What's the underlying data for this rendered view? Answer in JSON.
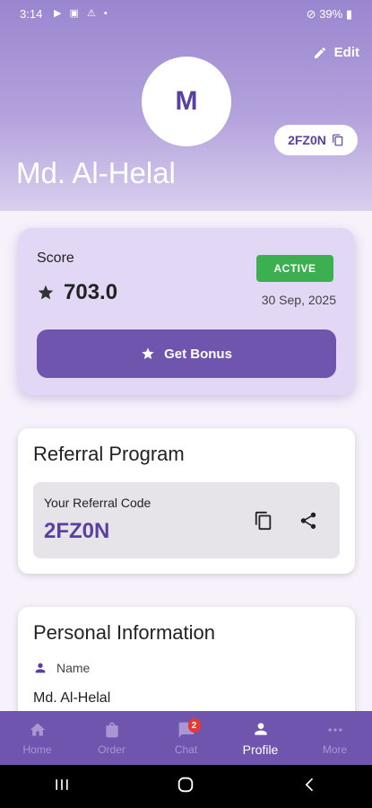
{
  "status_bar": {
    "time": "3:14",
    "battery": "39%"
  },
  "header": {
    "edit_label": "Edit",
    "avatar_initial": "M",
    "referral_code_pill": "2FZ0N",
    "user_name": "Md. Al-Helal"
  },
  "score_card": {
    "label": "Score",
    "value": "703.0",
    "status": "ACTIVE",
    "date": "30 Sep, 2025",
    "bonus_button": "Get Bonus"
  },
  "referral": {
    "title": "Referral Program",
    "code_label": "Your Referral Code",
    "code": "2FZ0N"
  },
  "personal_info": {
    "title": "Personal Information",
    "name_label": "Name",
    "name_value": "Md. Al-Helal"
  },
  "bottom_nav": {
    "items": [
      {
        "label": "Home",
        "icon": "home-icon"
      },
      {
        "label": "Order",
        "icon": "bag-icon"
      },
      {
        "label": "Chat",
        "icon": "chat-icon",
        "badge": "2"
      },
      {
        "label": "Profile",
        "icon": "person-icon",
        "active": true
      },
      {
        "label": "More",
        "icon": "more-icon"
      }
    ]
  },
  "colors": {
    "primary": "#6f55ad",
    "accent_text": "#5a3fa0",
    "status_active": "#3cb051",
    "badge": "#e53935"
  }
}
